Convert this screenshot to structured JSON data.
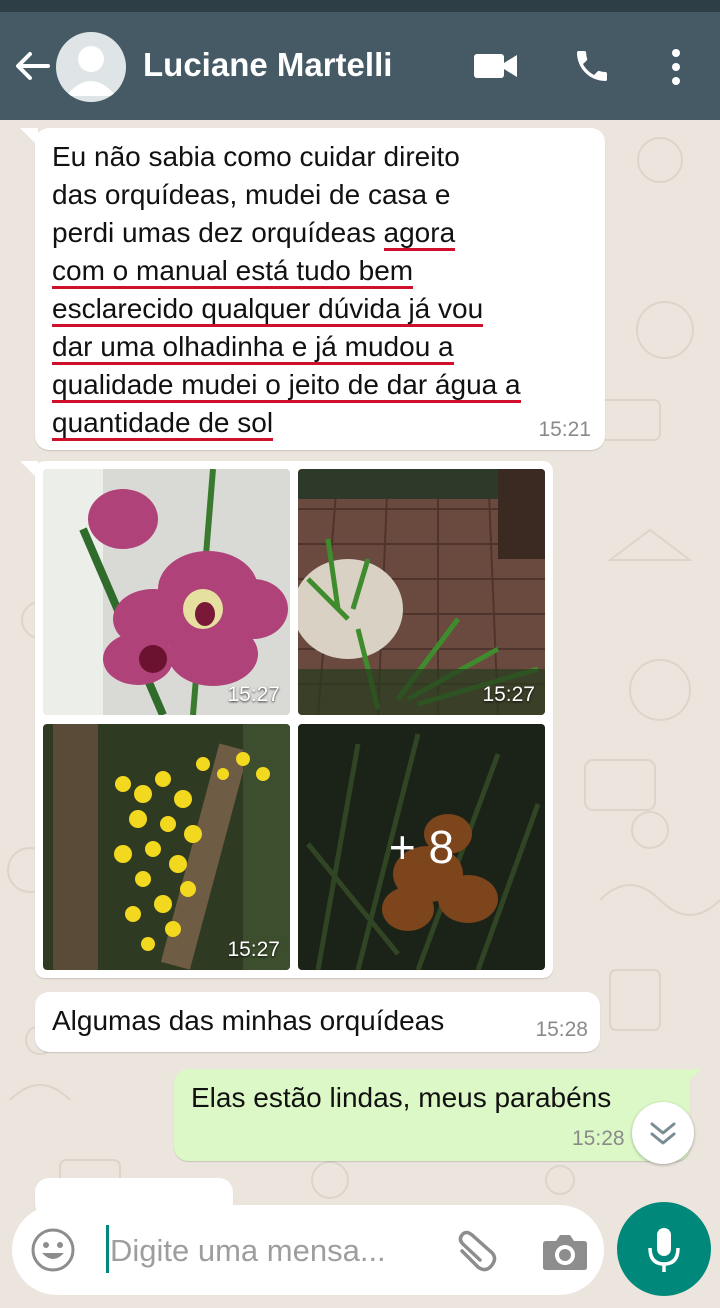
{
  "header": {
    "contact_name": "Luciane Martelli",
    "icons": [
      "back-arrow-icon",
      "avatar",
      "video-call-icon",
      "phone-icon",
      "more-vertical-icon"
    ]
  },
  "messages": [
    {
      "direction": "in",
      "lines": [
        [
          "Eu não sabia como cuidar direito"
        ],
        [
          "das orquídeas, mudei de casa e"
        ],
        [
          "perdi umas dez orquídeas ",
          "agora"
        ],
        [
          "",
          "com o manual está tudo bem"
        ],
        [
          "",
          "esclarecido qualquer dúvida já vou"
        ],
        [
          "",
          "dar uma olhadinha e já mudou a"
        ],
        [
          "",
          "qualidade mudei o jeito de dar água a"
        ],
        [
          "",
          "quantidade de sol"
        ]
      ],
      "time": "15:21"
    },
    {
      "direction": "in",
      "type": "photo-grid",
      "photos": [
        {
          "subject": "pink orchid",
          "time": "15:27"
        },
        {
          "subject": "potted plants on brick patio",
          "time": "15:27"
        },
        {
          "subject": "yellow orchid on tree",
          "time": "15:27"
        },
        {
          "subject": "orange orchid",
          "more": "+ 8"
        }
      ]
    },
    {
      "direction": "in",
      "text": "Algumas das minhas orquídeas",
      "time": "15:28"
    },
    {
      "direction": "out",
      "text": "Elas estão lindas, meus parabéns",
      "time": "15:28"
    }
  ],
  "composer": {
    "placeholder": "Digite uma mensa...",
    "icons": [
      "emoji-icon",
      "attach-icon",
      "camera-icon",
      "mic-icon"
    ]
  },
  "colors": {
    "header": "#455a64",
    "outgoing_bubble": "#dcf8c6",
    "accent": "#00897b",
    "underline": "#d0102a"
  }
}
